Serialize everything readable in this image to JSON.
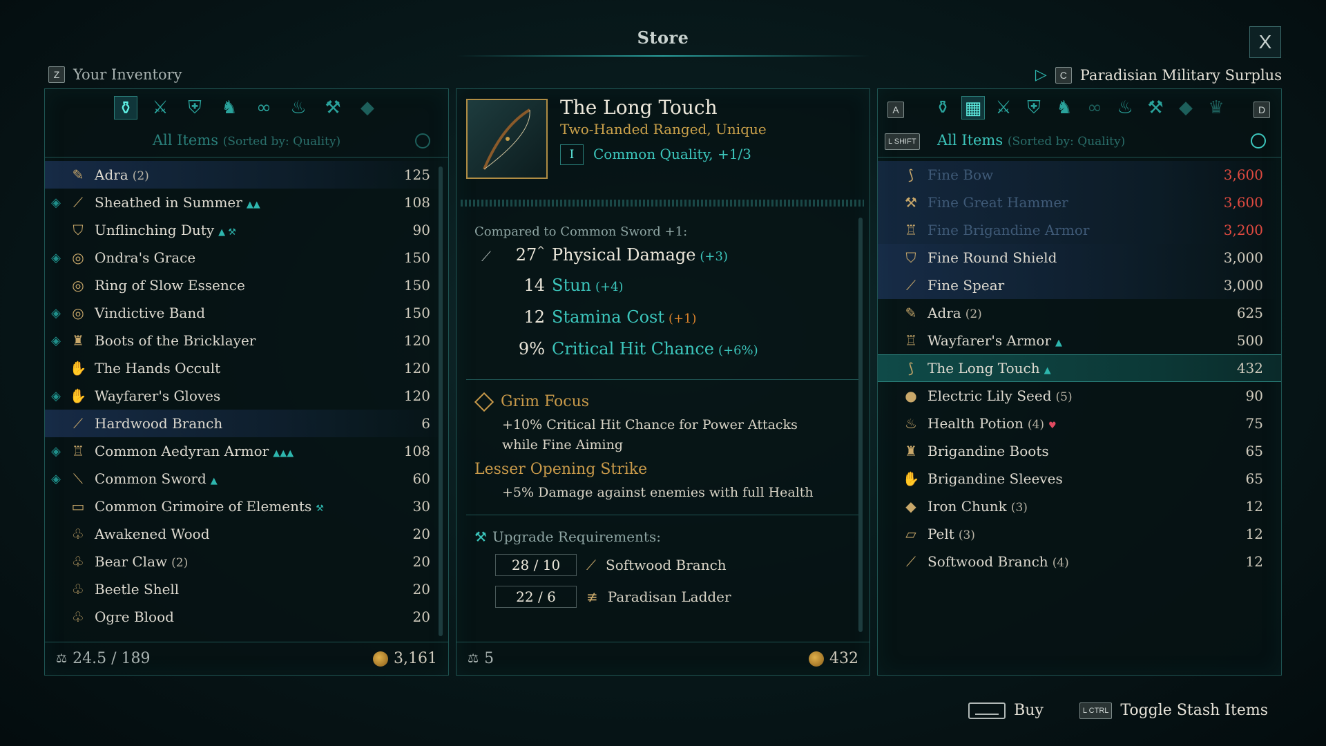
{
  "title": "Store",
  "close_label": "X",
  "inventory": {
    "key": "Z",
    "label": "Your Inventory",
    "categories": [
      {
        "icon": "bag-icon",
        "glyph": "⚱",
        "state": "active"
      },
      {
        "icon": "weapons-icon",
        "glyph": "⚔",
        "state": "normal"
      },
      {
        "icon": "armor-icon",
        "glyph": "⛨",
        "state": "normal"
      },
      {
        "icon": "boots-icon",
        "glyph": "♞",
        "state": "normal"
      },
      {
        "icon": "rings-icon",
        "glyph": "∞",
        "state": "normal"
      },
      {
        "icon": "consumables-icon",
        "glyph": "♨",
        "state": "normal"
      },
      {
        "icon": "anvil-icon",
        "glyph": "⚒",
        "state": "normal"
      },
      {
        "icon": "gem-icon",
        "glyph": "◆",
        "state": "dim"
      }
    ],
    "sort_label": "All Items",
    "sort_detail": "(Sorted by: Quality)",
    "items": [
      {
        "name": "Adra",
        "count": "(2)",
        "value": "125",
        "icon": "adra-icon",
        "glyph": "✎",
        "diamond": false,
        "marks": "",
        "highlight": true
      },
      {
        "name": "Sheathed in Summer",
        "count": "",
        "value": "108",
        "icon": "sword-icon",
        "glyph": "⟋",
        "diamond": true,
        "marks": "▲▲",
        "highlight": false
      },
      {
        "name": "Unflinching Duty",
        "count": "",
        "value": "90",
        "icon": "shield-icon",
        "glyph": "⛉",
        "diamond": false,
        "marks": "▲ ⚒",
        "highlight": false
      },
      {
        "name": "Ondra's Grace",
        "count": "",
        "value": "150",
        "icon": "ring-icon",
        "glyph": "◎",
        "diamond": true,
        "marks": "",
        "highlight": false
      },
      {
        "name": "Ring of Slow Essence",
        "count": "",
        "value": "150",
        "icon": "ring-icon",
        "glyph": "◎",
        "diamond": false,
        "marks": "",
        "highlight": false
      },
      {
        "name": "Vindictive Band",
        "count": "",
        "value": "150",
        "icon": "ring-icon",
        "glyph": "◎",
        "diamond": true,
        "marks": "",
        "highlight": false
      },
      {
        "name": "Boots of the Bricklayer",
        "count": "",
        "value": "120",
        "icon": "boots-icon",
        "glyph": "♜",
        "diamond": true,
        "marks": "",
        "highlight": false
      },
      {
        "name": "The Hands Occult",
        "count": "",
        "value": "120",
        "icon": "gloves-icon",
        "glyph": "✋",
        "diamond": false,
        "marks": "",
        "highlight": false
      },
      {
        "name": "Wayfarer's Gloves",
        "count": "",
        "value": "120",
        "icon": "gloves-icon",
        "glyph": "✋",
        "diamond": true,
        "marks": "",
        "highlight": false
      },
      {
        "name": "Hardwood Branch",
        "count": "",
        "value": "6",
        "icon": "branch-icon",
        "glyph": "⟋",
        "diamond": false,
        "marks": "",
        "highlight": true
      },
      {
        "name": "Common Aedyran Armor",
        "count": "",
        "value": "108",
        "icon": "armor-icon",
        "glyph": "♖",
        "diamond": true,
        "marks": "▲▲▲",
        "highlight": false
      },
      {
        "name": "Common Sword",
        "count": "",
        "value": "60",
        "icon": "sword-icon",
        "glyph": "⟍",
        "diamond": true,
        "marks": "▲",
        "highlight": false
      },
      {
        "name": "Common Grimoire of Elements",
        "count": "",
        "value": "30",
        "icon": "grimoire-icon",
        "glyph": "▭",
        "diamond": false,
        "marks": "⚒",
        "highlight": false
      },
      {
        "name": "Awakened Wood",
        "count": "",
        "value": "20",
        "icon": "material-icon",
        "glyph": "♧",
        "diamond": false,
        "marks": "",
        "highlight": false
      },
      {
        "name": "Bear Claw",
        "count": "(2)",
        "value": "20",
        "icon": "material-icon",
        "glyph": "♧",
        "diamond": false,
        "marks": "",
        "highlight": false
      },
      {
        "name": "Beetle Shell",
        "count": "",
        "value": "20",
        "icon": "material-icon",
        "glyph": "♧",
        "diamond": false,
        "marks": "",
        "highlight": false
      },
      {
        "name": "Ogre Blood",
        "count": "",
        "value": "20",
        "icon": "material-icon",
        "glyph": "♧",
        "diamond": false,
        "marks": "",
        "highlight": false
      }
    ],
    "weight": "24.5 / 189",
    "gold": "3,161"
  },
  "detail": {
    "name": "The Long Touch",
    "type": "Two-Handed Ranged, Unique",
    "quality_badge": "I",
    "quality": "Common Quality, +1/3",
    "compared": "Compared to Common Sword +1:",
    "stats": [
      {
        "value": "27",
        "up": "^",
        "label": "Physical Damage",
        "delta": "(+3)",
        "color": "#ece7da",
        "delta_color": "#3cc6bc",
        "icon": "physical-damage-icon",
        "glyph": "⟋"
      },
      {
        "value": "14",
        "up": "",
        "label": "Stun",
        "delta": "(+4)",
        "color": "#3cc6bc",
        "delta_color": "#3cc6bc",
        "icon": "",
        "glyph": ""
      },
      {
        "value": "12",
        "up": "",
        "label": "Stamina Cost",
        "delta": "(+1)",
        "color": "#3cc6bc",
        "delta_color": "#d9822b",
        "icon": "",
        "glyph": ""
      },
      {
        "value": "9%",
        "up": "",
        "label": "Critical Hit Chance",
        "delta": "(+6%)",
        "color": "#3cc6bc",
        "delta_color": "#3cc6bc",
        "icon": "",
        "glyph": ""
      }
    ],
    "perks": [
      {
        "title": "Grim Focus",
        "desc": "+10% Critical Hit Chance for Power Attacks while Fine Aiming"
      },
      {
        "title": "Lesser Opening Strike",
        "desc": "+5% Damage against enemies with full Health"
      }
    ],
    "upgrade_label": "Upgrade Requirements:",
    "upgrades": [
      {
        "amount": "28 / 10",
        "name": "Softwood Branch",
        "icon": "branch-icon",
        "glyph": "⟋"
      },
      {
        "amount": "22 / 6",
        "name": "Paradisan Ladder",
        "icon": "ladder-icon",
        "glyph": "≢"
      }
    ],
    "weight": "5",
    "gold": "432"
  },
  "vendor": {
    "key": "C",
    "label": "Paradisian Military Surplus",
    "left_key": "A",
    "right_key": "D",
    "shift_key": "L SHIFT",
    "categories": [
      {
        "icon": "bag-icon",
        "glyph": "⚱",
        "state": "normal"
      },
      {
        "icon": "all-items-icon",
        "glyph": "▦",
        "state": "active"
      },
      {
        "icon": "weapons-icon",
        "glyph": "⚔",
        "state": "normal"
      },
      {
        "icon": "armor-icon",
        "glyph": "⛨",
        "state": "normal"
      },
      {
        "icon": "boots-icon",
        "glyph": "♞",
        "state": "normal"
      },
      {
        "icon": "rings-icon",
        "glyph": "∞",
        "state": "dim"
      },
      {
        "icon": "consumables-icon",
        "glyph": "♨",
        "state": "normal"
      },
      {
        "icon": "anvil-icon",
        "glyph": "⚒",
        "state": "normal"
      },
      {
        "icon": "gem-icon",
        "glyph": "◆",
        "state": "dim"
      },
      {
        "icon": "crown-icon",
        "glyph": "♛",
        "state": "dim"
      }
    ],
    "sort_label": "All Items",
    "sort_detail": "(Sorted by: Quality)",
    "items": [
      {
        "name": "Fine Bow",
        "count": "",
        "value": "3,600",
        "icon": "bow-icon",
        "glyph": "⟆",
        "state": "unaffordable",
        "marks": ""
      },
      {
        "name": "Fine Great Hammer",
        "count": "",
        "value": "3,600",
        "icon": "hammer-icon",
        "glyph": "⚒",
        "state": "unaffordable",
        "marks": ""
      },
      {
        "name": "Fine Brigandine Armor",
        "count": "",
        "value": "3,200",
        "icon": "armor-icon",
        "glyph": "♖",
        "state": "unaffordable",
        "marks": ""
      },
      {
        "name": "Fine Round Shield",
        "count": "",
        "value": "3,000",
        "icon": "shield-icon",
        "glyph": "⛉",
        "state": "highlight",
        "marks": ""
      },
      {
        "name": "Fine Spear",
        "count": "",
        "value": "3,000",
        "icon": "spear-icon",
        "glyph": "⟋",
        "state": "highlight",
        "marks": ""
      },
      {
        "name": "Adra",
        "count": "(2)",
        "value": "625",
        "icon": "adra-icon",
        "glyph": "✎",
        "state": "normal",
        "marks": ""
      },
      {
        "name": "Wayfarer's Armor",
        "count": "",
        "value": "500",
        "icon": "armor-icon",
        "glyph": "♖",
        "state": "normal",
        "marks": "▲"
      },
      {
        "name": "The Long Touch",
        "count": "",
        "value": "432",
        "icon": "bow-icon",
        "glyph": "⟆",
        "state": "selected",
        "marks": "▲"
      },
      {
        "name": "Electric Lily Seed",
        "count": "(5)",
        "value": "90",
        "icon": "seed-icon",
        "glyph": "●",
        "state": "normal",
        "marks": ""
      },
      {
        "name": "Health Potion",
        "count": "(4)",
        "value": "75",
        "icon": "potion-icon",
        "glyph": "♨",
        "state": "normal",
        "marks": "♥"
      },
      {
        "name": "Brigandine Boots",
        "count": "",
        "value": "65",
        "icon": "boots-icon",
        "glyph": "♜",
        "state": "normal",
        "marks": ""
      },
      {
        "name": "Brigandine Sleeves",
        "count": "",
        "value": "65",
        "icon": "gloves-icon",
        "glyph": "✋",
        "state": "normal",
        "marks": ""
      },
      {
        "name": "Iron Chunk",
        "count": "(3)",
        "value": "12",
        "icon": "iron-icon",
        "glyph": "◆",
        "state": "normal",
        "marks": ""
      },
      {
        "name": "Pelt",
        "count": "(3)",
        "value": "12",
        "icon": "pelt-icon",
        "glyph": "▱",
        "state": "normal",
        "marks": ""
      },
      {
        "name": "Softwood Branch",
        "count": "(4)",
        "value": "12",
        "icon": "branch-icon",
        "glyph": "⟋",
        "state": "normal",
        "marks": ""
      }
    ]
  },
  "actions": {
    "buy_label": "Buy",
    "ctrl_key": "L CTRL",
    "toggle_label": "Toggle Stash Items"
  }
}
